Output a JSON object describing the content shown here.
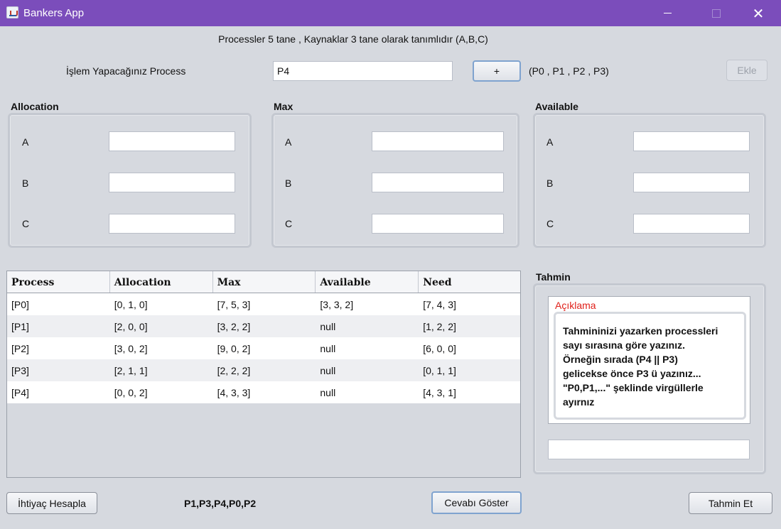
{
  "window": {
    "title": "Bankers App",
    "minimize": "",
    "maximize": "",
    "close": "✕"
  },
  "header": {
    "text": "Processler 5 tane , Kaynaklar 3 tane olarak tanımlıdır (A,B,C)"
  },
  "process_row": {
    "label": "İşlem Yapacağınız Process",
    "input_value": "P4",
    "plus_label": "+",
    "hint": "(P0 , P1 , P2 , P3)",
    "add_label": "Ekle"
  },
  "allocation": {
    "title": "Allocation",
    "a": "A",
    "b": "B",
    "c": "C",
    "a_value": "",
    "b_value": "",
    "c_value": ""
  },
  "max": {
    "title": "Max",
    "a": "A",
    "b": "B",
    "c": "C",
    "a_value": "",
    "b_value": "",
    "c_value": ""
  },
  "available": {
    "title": "Available",
    "a": "A",
    "b": "B",
    "c": "C",
    "a_value": "",
    "b_value": "",
    "c_value": ""
  },
  "table": {
    "headers": [
      "Process",
      "Allocation",
      "Max",
      "Available",
      "Need"
    ],
    "rows": [
      [
        "[P0]",
        "[0, 1, 0]",
        "[7, 5, 3]",
        "[3, 3, 2]",
        "[7, 4, 3]"
      ],
      [
        "[P1]",
        "[2, 0, 0]",
        "[3, 2, 2]",
        "null",
        "[1, 2, 2]"
      ],
      [
        "[P2]",
        "[3, 0, 2]",
        "[9, 0, 2]",
        "null",
        "[6, 0, 0]"
      ],
      [
        "[P3]",
        "[2, 1, 1]",
        "[2, 2, 2]",
        "null",
        "[0, 1, 1]"
      ],
      [
        "[P4]",
        "[0, 0, 2]",
        "[4, 3, 3]",
        "null",
        "[4, 3, 1]"
      ]
    ]
  },
  "guess": {
    "title": "Tahmin",
    "desc_title": "Açıklama",
    "desc_lines": [
      "Tahmininizi yazarken processleri",
      "sayı sırasına göre yazınız.",
      "Örneğin sırada (P4 || P3)",
      "gelicekse önce P3 ü yazınız...",
      "\"P0,P1,...\" şeklinde virgüllerle",
      "ayırnız"
    ],
    "input_value": ""
  },
  "footer": {
    "need_button": "İhtiyaç Hesapla",
    "answer": "P1,P3,P4,P0,P2",
    "show_answer_button": "Cevabı Göster",
    "guess_button": "Tahmin Et"
  }
}
